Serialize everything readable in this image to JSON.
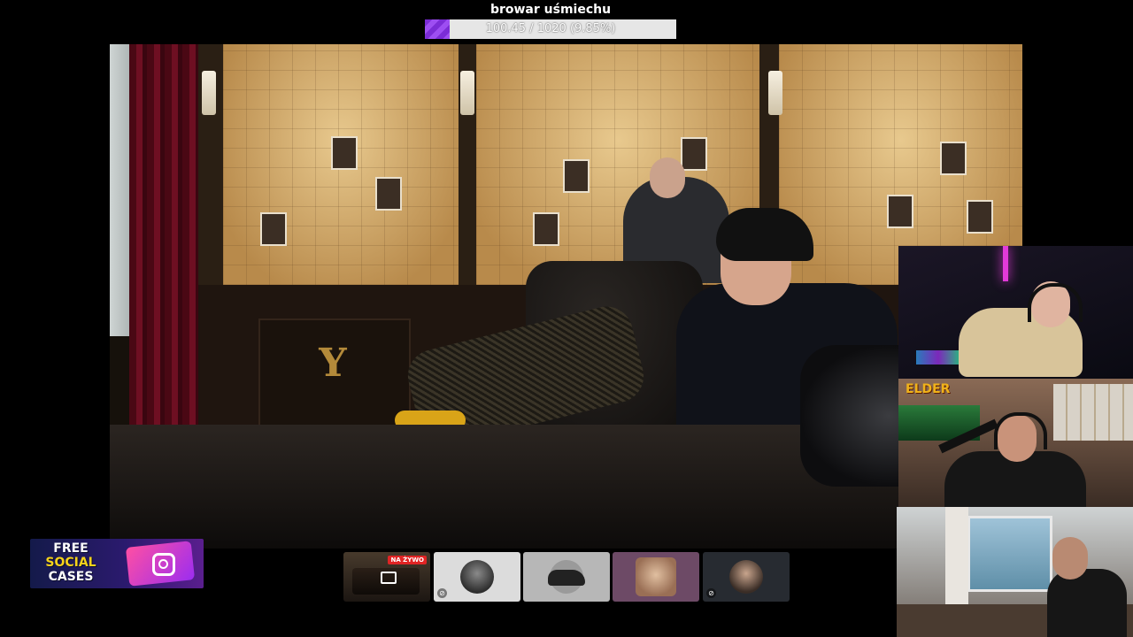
{
  "donation_goal": {
    "title": "browar uśmiechu",
    "progress_text": "100.45 / 1020 (9.85%)",
    "progress_fraction": 0.0985,
    "fill_color": "#7b2cd6"
  },
  "webcams": {
    "cam2_logo": "ELDER"
  },
  "promo": {
    "line1": "FREE",
    "line2": "SOCIAL",
    "line3": "CASES",
    "icon": "instagram-icon"
  },
  "participants": {
    "live_badge": "NA ŻYWO",
    "tiles": [
      {
        "icon": "screen-share-icon"
      },
      {
        "icon": "mic-muted-icon"
      },
      {
        "icon": "car-avatar"
      },
      {
        "icon": "avatar"
      },
      {
        "icon": "mic-muted-icon"
      }
    ]
  }
}
